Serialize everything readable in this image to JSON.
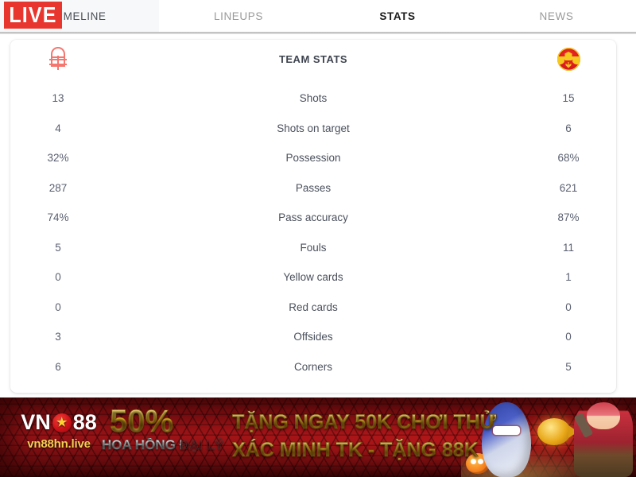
{
  "tabs": [
    {
      "label": "TIMELINE",
      "active": false
    },
    {
      "label": "LINEUPS",
      "active": false
    },
    {
      "label": "STATS",
      "active": true
    },
    {
      "label": "NEWS",
      "active": false
    }
  ],
  "live_badge": {
    "label": "LIVE",
    "color": "#e8362e"
  },
  "stats": {
    "title": "TEAM STATS",
    "home_team_crest": "nottingham-forest-crest",
    "away_team_crest": "manchester-united-crest",
    "rows": [
      {
        "label": "Shots",
        "home": "13",
        "away": "15"
      },
      {
        "label": "Shots on target",
        "home": "4",
        "away": "6"
      },
      {
        "label": "Possession",
        "home": "32%",
        "away": "68%"
      },
      {
        "label": "Passes",
        "home": "287",
        "away": "621"
      },
      {
        "label": "Pass accuracy",
        "home": "74%",
        "away": "87%"
      },
      {
        "label": "Fouls",
        "home": "5",
        "away": "11"
      },
      {
        "label": "Yellow cards",
        "home": "0",
        "away": "1"
      },
      {
        "label": "Red cards",
        "home": "0",
        "away": "0"
      },
      {
        "label": "Offsides",
        "home": "3",
        "away": "0"
      },
      {
        "label": "Corners",
        "home": "6",
        "away": "5"
      }
    ]
  },
  "ad": {
    "brand_prefix": "VN",
    "brand_suffix": "88",
    "brand_star": "★",
    "url": "vn88hn.live",
    "percent": "50%",
    "percent_sub": "HOA HỒNG ĐẠI LÝ",
    "line1": "TẶNG NGAY 50K CHƠI THỬ",
    "line2": "XÁC MINH TK - TẶNG 88K",
    "accent_gold": "#e8b828",
    "accent_red": "#9c1317"
  }
}
